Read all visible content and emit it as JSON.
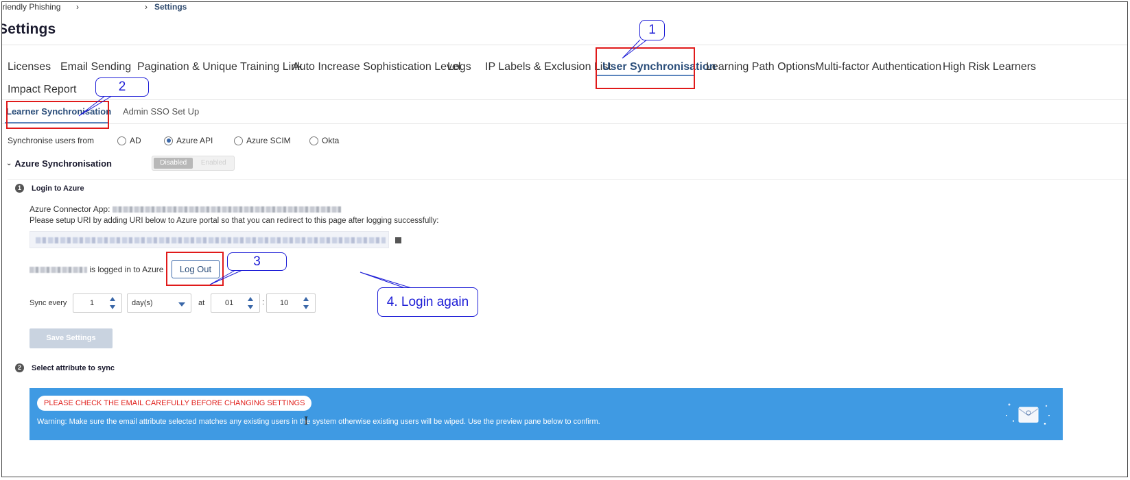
{
  "breadcrumb": {
    "items": [
      "hriendly Phishing",
      "Settings"
    ],
    "separator": "›"
  },
  "page_title": "Settings",
  "tabs": [
    {
      "label": "Licenses"
    },
    {
      "label": "Email Sending"
    },
    {
      "label": "Pagination & Unique Training Link"
    },
    {
      "label": "Auto Increase Sophistication Level"
    },
    {
      "label": "Logs"
    },
    {
      "label": "IP Labels & Exclusion List"
    },
    {
      "label": "User Synchronisation",
      "active": true
    },
    {
      "label": "Learning Path Options"
    },
    {
      "label": "Multi-factor Authentication"
    },
    {
      "label": "High Risk Learners"
    },
    {
      "label": "Impact Report"
    }
  ],
  "subtabs": [
    {
      "label": "Learner Synchronisation",
      "active": true
    },
    {
      "label": "Admin SSO Set Up"
    }
  ],
  "sync_source": {
    "label": "Synchronise users from",
    "options": [
      "AD",
      "Azure API",
      "Azure SCIM",
      "Okta"
    ],
    "selected": "Azure API"
  },
  "azure": {
    "title": "Azure Synchronisation",
    "toggle": {
      "on_label": "Disabled",
      "off_label": "Enabled"
    }
  },
  "step1": {
    "number": "1",
    "title": "Login to Azure",
    "connector_label": "Azure Connector App:",
    "instructions": "Please setup URI by adding URI below to Azure portal so that you can redirect to this page after logging successfully:",
    "logged_in_text": "is logged in to Azure",
    "logout_label": "Log Out"
  },
  "schedule": {
    "sync_every_label": "Sync every",
    "interval": "1",
    "unit": "day(s)",
    "at_label": "at",
    "hour": "01",
    "colon": ":",
    "minute": "10"
  },
  "save_label": "Save Settings",
  "step2": {
    "number": "2",
    "title": "Select attribute to sync"
  },
  "warning": {
    "pill": "PLEASE CHECK THE EMAIL CAREFULLY BEFORE CHANGING SETTINGS",
    "text": "Warning: Make sure the email attribute selected matches any existing users in the system otherwise existing users will be wiped. Use the preview pane below to confirm."
  },
  "callouts": {
    "c1": "1",
    "c2": "2",
    "c3": "3",
    "c4": "4. Login again"
  },
  "colors": {
    "accent": "#3a67a8",
    "annotation_red": "#e01a1a",
    "annotation_blue": "#1c1cd6",
    "warning_panel": "#3f9ae3",
    "warning_pill_text": "#e0201c"
  }
}
